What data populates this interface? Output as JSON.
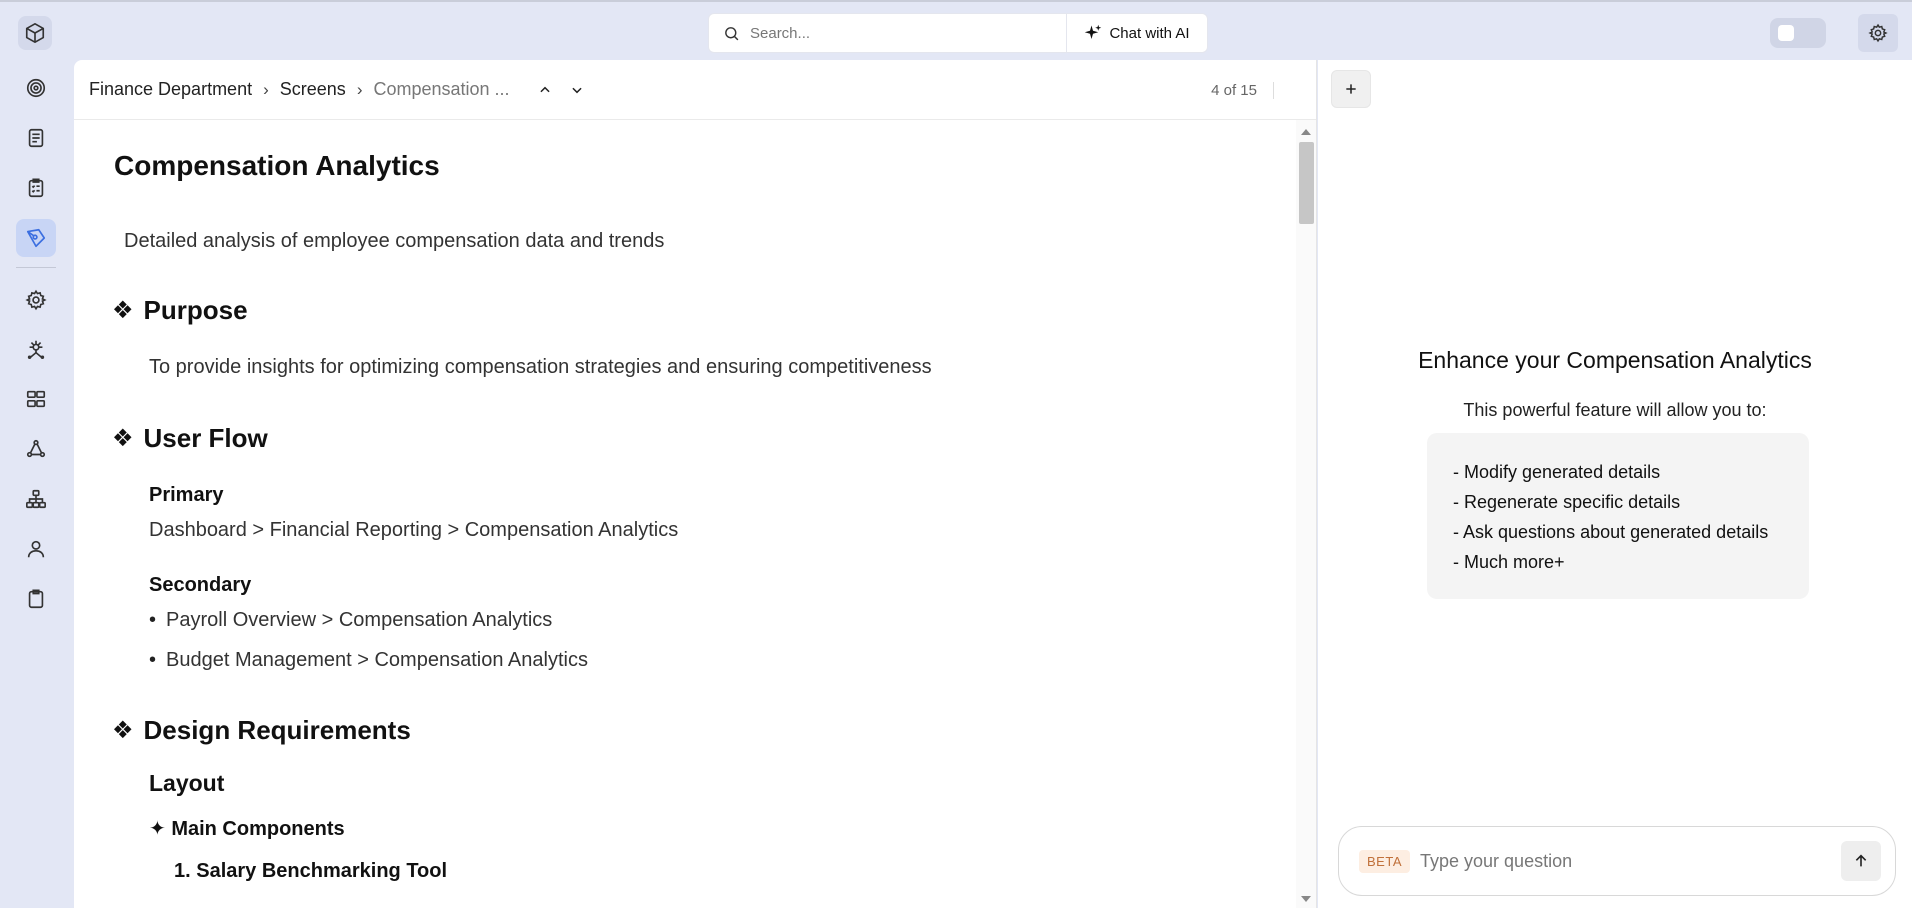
{
  "topbar": {
    "search_placeholder": "Search...",
    "chat_label": "Chat with AI"
  },
  "sidebar": {
    "items": [
      {
        "icon": "target-icon"
      },
      {
        "icon": "document-icon"
      },
      {
        "icon": "checklist-icon"
      },
      {
        "icon": "pen-tool-icon",
        "active": true
      },
      {
        "icon": "settings-icon"
      },
      {
        "icon": "integration-icon"
      },
      {
        "icon": "components-icon"
      },
      {
        "icon": "flow-icon"
      },
      {
        "icon": "hierarchy-icon"
      },
      {
        "icon": "user-icon"
      },
      {
        "icon": "clipboard-icon"
      }
    ]
  },
  "breadcrumb": {
    "items": [
      "Finance Department",
      "Screens",
      "Compensation ..."
    ],
    "counter": "4 of 15"
  },
  "doc": {
    "title": "Compensation Analytics",
    "description": "Detailed analysis of employee compensation data and trends",
    "purpose_heading": "Purpose",
    "purpose_text": "To provide insights for optimizing compensation strategies and ensuring competitiveness",
    "userflow_heading": "User Flow",
    "primary_label": "Primary",
    "primary_text": "Dashboard > Financial Reporting > Compensation Analytics",
    "secondary_label": "Secondary",
    "secondary_items": [
      "Payroll Overview > Compensation Analytics",
      "Budget Management > Compensation Analytics"
    ],
    "design_heading": "Design Requirements",
    "layout_heading": "Layout",
    "main_components_heading": "✦ Main Components",
    "tool_heading": "1. Salary Benchmarking Tool"
  },
  "assistant": {
    "title": "Enhance your Compensation Analytics",
    "subtitle": "This powerful feature will allow you to:",
    "features": [
      "- Modify generated details",
      "- Regenerate specific details",
      "- Ask questions about generated details",
      "- Much more+"
    ],
    "beta_label": "BETA",
    "input_placeholder": "Type your question"
  },
  "colors": {
    "accent": "#3b6fe0",
    "background": "#e3e7f5",
    "active_item": "#c8d5f5",
    "beta_bg": "#fdeee2",
    "beta_text": "#c0703a"
  }
}
